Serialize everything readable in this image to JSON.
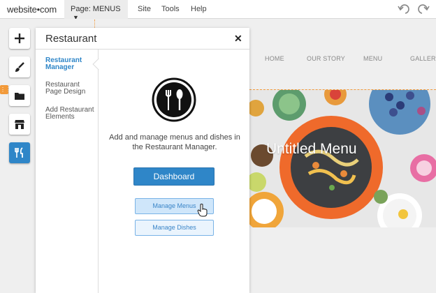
{
  "topbar": {
    "logo": "website•com",
    "page_select": "Page: MENUS",
    "nav": [
      "Site",
      "Tools",
      "Help"
    ]
  },
  "site_nav": [
    "HOME",
    "OUR STORY",
    "MENU",
    "GALLERY"
  ],
  "hero": {
    "title": "Untitled Menu"
  },
  "panel": {
    "title": "Restaurant",
    "close": "✕",
    "side_items": [
      "Restaurant Manager",
      "Restaurant Page Design",
      "Add Restaurant Elements"
    ],
    "description": "Add and manage menus and dishes in the Restaurant Manager.",
    "dashboard_button": "Dashboard",
    "manage_menus_button": "Manage Menus",
    "manage_dishes_button": "Manage Dishes"
  },
  "toolbar_icons": [
    "plus-icon",
    "brush-icon",
    "folder-icon",
    "store-icon",
    "fork-knife-icon"
  ],
  "colors": {
    "accent": "#2f86c8",
    "orange": "#f29a3a",
    "plate": "#ef6a2b"
  }
}
